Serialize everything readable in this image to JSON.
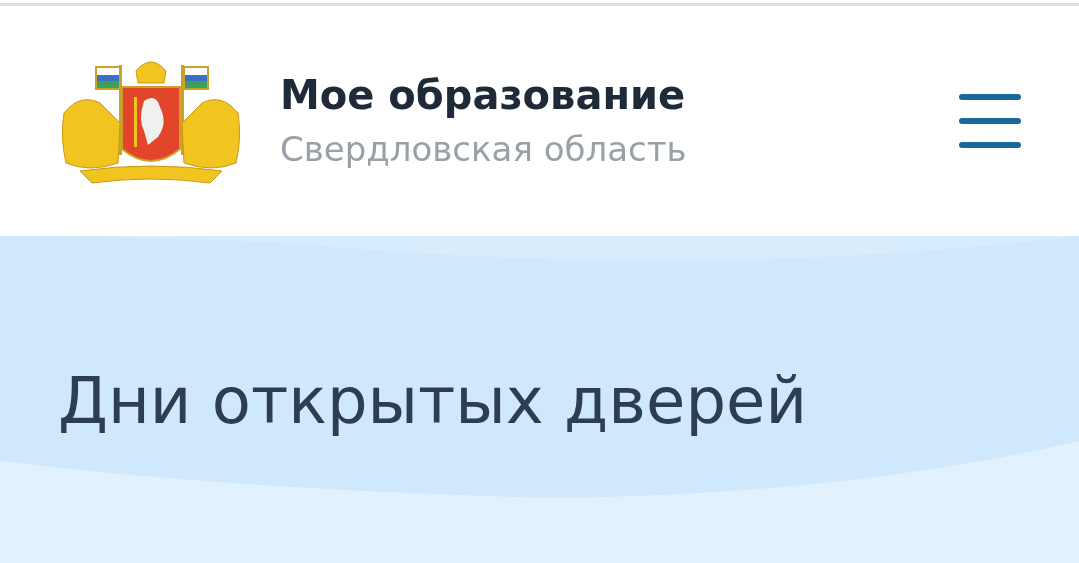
{
  "header": {
    "title": "Мое образование",
    "subtitle": "Свердловская область"
  },
  "hero": {
    "heading": "Дни открытых дверей"
  }
}
